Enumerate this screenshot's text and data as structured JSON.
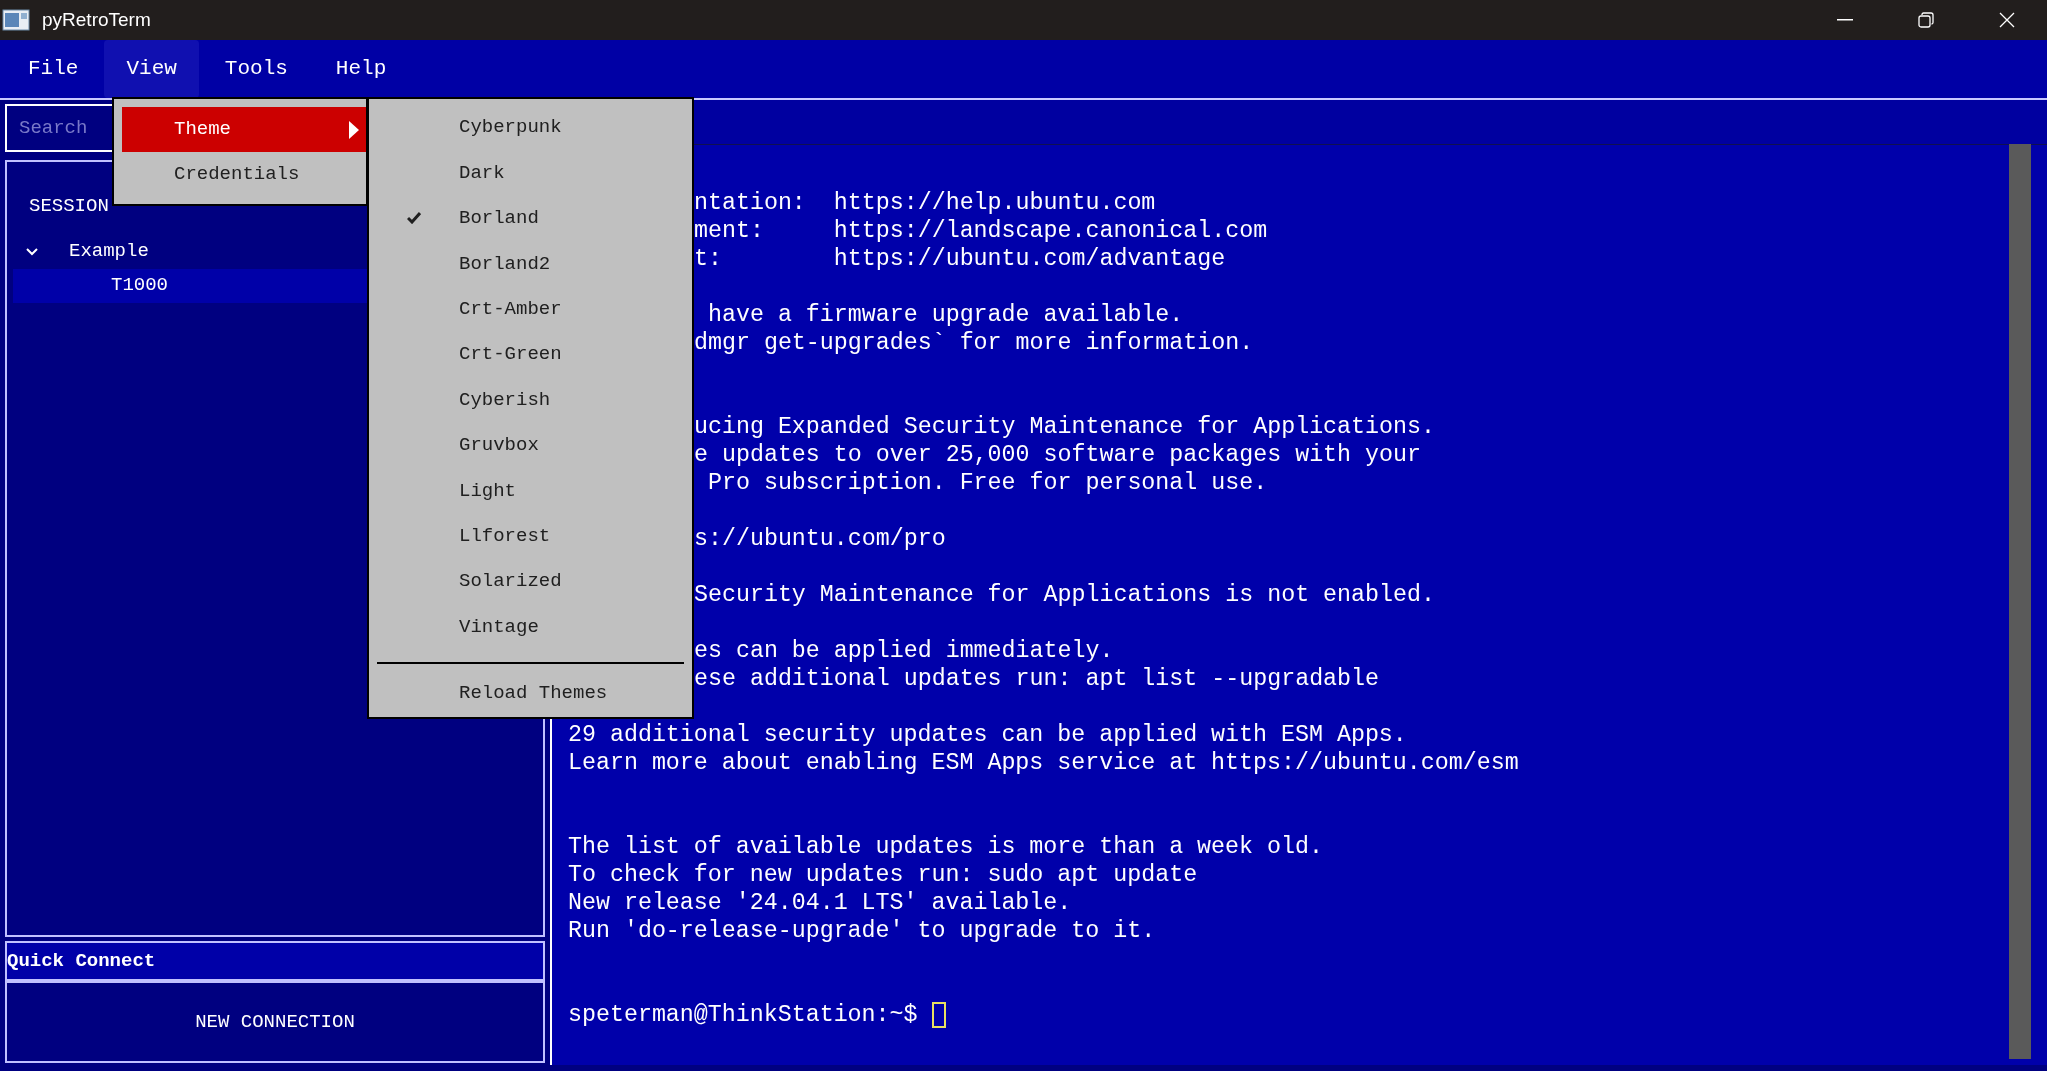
{
  "window": {
    "title": "pyRetroTerm"
  },
  "menu_bar": [
    {
      "label": "File",
      "selected": false
    },
    {
      "label": "View",
      "selected": true
    },
    {
      "label": "Tools",
      "selected": false
    },
    {
      "label": "Help",
      "selected": false
    }
  ],
  "view_menu": {
    "items": [
      {
        "label": "Theme",
        "selected": true,
        "kind": "submenu"
      },
      {
        "label": "Credentials",
        "selected": false,
        "kind": "action"
      }
    ]
  },
  "theme_menu": {
    "items": [
      {
        "label": "Cyberpunk",
        "checked": false
      },
      {
        "label": "Dark",
        "checked": false
      },
      {
        "label": "Borland",
        "checked": true
      },
      {
        "label": "Borland2",
        "checked": false
      },
      {
        "label": "Crt-Amber",
        "checked": false
      },
      {
        "label": "Crt-Green",
        "checked": false
      },
      {
        "label": "Cyberish",
        "checked": false
      },
      {
        "label": "Gruvbox",
        "checked": false
      },
      {
        "label": "Light",
        "checked": false
      },
      {
        "label": "Llforest",
        "checked": false
      },
      {
        "label": "Solarized",
        "checked": false
      },
      {
        "label": "Vintage",
        "checked": false
      }
    ],
    "footer": "Reload Themes"
  },
  "sidebar": {
    "search": {
      "placeholder": "Search"
    },
    "sessions_heading": "SESSION",
    "tree": [
      {
        "label": "Example",
        "expanded": true,
        "selected": false,
        "children": [
          {
            "label": "T1000",
            "selected": true
          }
        ]
      }
    ],
    "quick_connect": {
      "title": "Quick Connect",
      "button": "NEW CONNECTION"
    }
  },
  "terminal": {
    "lines": [
      {
        "kind": "covered",
        "text": "ntation:  https://help.ubuntu.com"
      },
      {
        "kind": "covered",
        "text": "ment:     https://landscape.canonical.com"
      },
      {
        "kind": "covered",
        "text": "t:        https://ubuntu.com/advantage"
      },
      {
        "kind": "gap"
      },
      {
        "kind": "covered",
        "text": " have a firmware upgrade available."
      },
      {
        "kind": "covered",
        "text": "dmgr get-upgrades` for more information."
      },
      {
        "kind": "gap"
      },
      {
        "kind": "gap"
      },
      {
        "kind": "covered",
        "text": "ucing Expanded Security Maintenance for Applications."
      },
      {
        "kind": "covered",
        "text": "e updates to over 25,000 software packages with your"
      },
      {
        "kind": "covered",
        "text": " Pro subscription. Free for personal use."
      },
      {
        "kind": "gap"
      },
      {
        "kind": "covered",
        "text": "s://ubuntu.com/pro"
      },
      {
        "kind": "gap"
      },
      {
        "kind": "covered",
        "text": "Security Maintenance for Applications is not enabled."
      },
      {
        "kind": "gap"
      },
      {
        "kind": "covered",
        "text": "es can be applied immediately."
      },
      {
        "kind": "covered",
        "text": "ese additional updates run: apt list --upgradable"
      },
      {
        "kind": "gap"
      },
      {
        "kind": "text",
        "text": "29 additional security updates can be applied with ESM Apps."
      },
      {
        "kind": "text",
        "text": "Learn more about enabling ESM Apps service at https://ubuntu.com/esm"
      },
      {
        "kind": "gap"
      },
      {
        "kind": "gap"
      },
      {
        "kind": "text",
        "text": "The list of available updates is more than a week old."
      },
      {
        "kind": "text",
        "text": "To check for new updates run: sudo apt update"
      },
      {
        "kind": "text",
        "text": "New release '24.04.1 LTS' available."
      },
      {
        "kind": "text",
        "text": "Run 'do-release-upgrade' to upgrade to it."
      },
      {
        "kind": "gap"
      },
      {
        "kind": "gap"
      }
    ],
    "prompt": "speterman@ThinkStation:~$"
  }
}
